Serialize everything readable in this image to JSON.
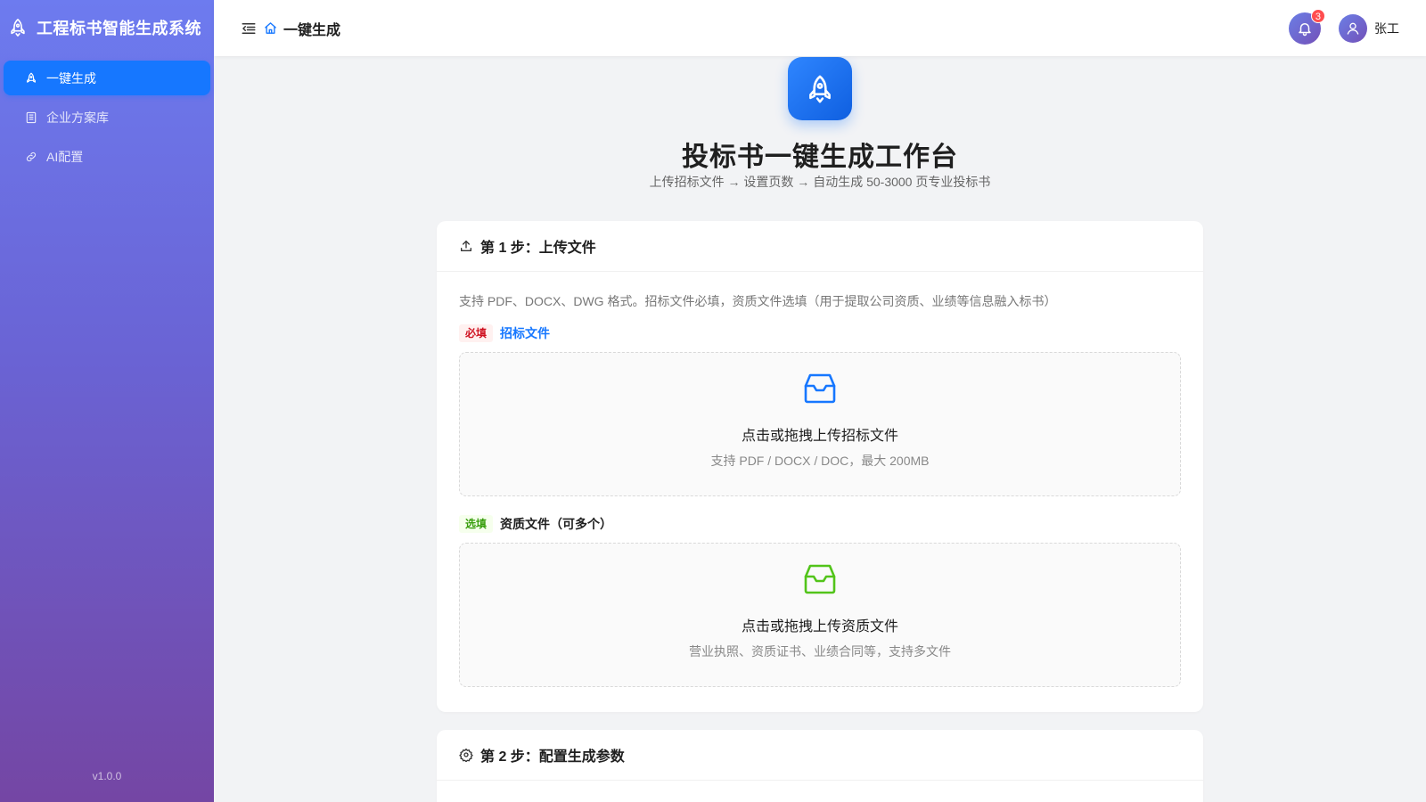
{
  "sidebar": {
    "brand_title": "工程标书智能生成系统",
    "items": [
      {
        "label": "一键生成",
        "icon": "rocket-icon",
        "active": true
      },
      {
        "label": "企业方案库",
        "icon": "book-icon",
        "active": false
      },
      {
        "label": "AI配置",
        "icon": "api-link-icon",
        "active": false
      }
    ],
    "version": "v1.0.0"
  },
  "header": {
    "title": "一键生成",
    "notification_count": "3",
    "user_name": "张工"
  },
  "hero": {
    "title": "投标书一键生成工作台",
    "subtitle": "上传招标文件 → 设置页数 → 自动生成 50-3000 页专业投标书"
  },
  "step1": {
    "title": "第 1 步：上传文件",
    "description": "支持 PDF、DOCX、DWG 格式。招标文件必填，资质文件选填（用于提取公司资质、业绩等信息融入标书）",
    "tender": {
      "tag": "必填",
      "label": "招标文件",
      "drop_text": "点击或拖拽上传招标文件",
      "drop_hint": "支持 PDF / DOCX / DOC，最大 200MB"
    },
    "qualification": {
      "tag": "选填",
      "label": "资质文件（可多个）",
      "drop_text": "点击或拖拽上传资质文件",
      "drop_hint": "营业执照、资质证书、业绩合同等，支持多文件"
    }
  },
  "step2": {
    "title": "第 2 步：配置生成参数"
  },
  "colors": {
    "primary": "#1677ff",
    "success": "#52c41a",
    "danger": "#ff4d4f"
  }
}
